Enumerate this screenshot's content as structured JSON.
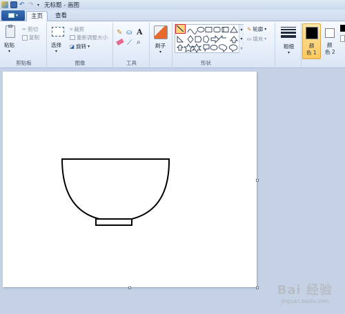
{
  "window": {
    "title": "无标题 - 画图"
  },
  "tabs": {
    "home": "主页",
    "view": "查看"
  },
  "groups": {
    "clipboard": {
      "label": "剪贴板",
      "paste": "粘贴",
      "cut": "剪切",
      "copy": "复制"
    },
    "image": {
      "label": "图像",
      "select": "选择",
      "crop": "裁剪",
      "resize": "重新调整大小",
      "rotate": "旋转"
    },
    "tools": {
      "label": "工具"
    },
    "brushes": {
      "label": "刷子"
    },
    "shapes": {
      "label": "形状",
      "outline": "轮廓",
      "fill": "填充"
    },
    "size": {
      "label": "粗细"
    },
    "color1": {
      "label_a": "颜",
      "label_b": "色 1"
    },
    "color2": {
      "label_a": "颜",
      "label_b": "色 2"
    }
  },
  "watermark": {
    "brand": "Bai 经验",
    "url": "jingyan.baidu.com"
  },
  "colors": {
    "accent": "#1f4f95",
    "active_shape_border": "#d22233",
    "color1": "#000000",
    "color2": "#ffffff"
  }
}
